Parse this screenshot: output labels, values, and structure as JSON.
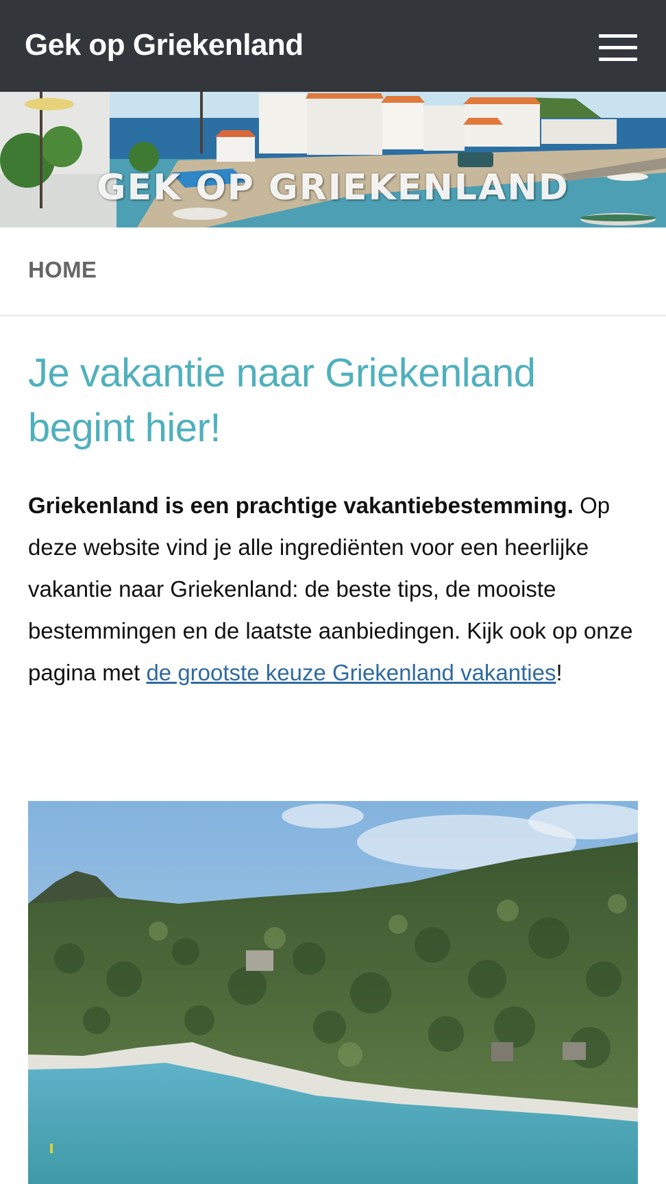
{
  "header": {
    "site_title": "Gek op Griekenland",
    "menu_icon": "hamburger-menu-icon",
    "background_color": "#33363b"
  },
  "banner": {
    "overlay_text": "GEK OP GRIEKENLAND"
  },
  "nav": {
    "items": [
      {
        "label": "HOME"
      }
    ]
  },
  "main": {
    "heading": "Je vakantie naar Griekenland begint hier!",
    "heading_color": "#4fb0bd",
    "intro": {
      "bold_text": "Griekenland is een prachtige vakantiebestemming.",
      "text": " Op deze website vind je alle ingrediënten voor een heerlijke vakantie naar Griekenland: de beste tips, de mooiste bestemmingen en de laatste aanbiedingen. Kijk ook op onze pagina met ",
      "link_text": "de grootste keuze Griekenland vakanties",
      "link_color": "#2f6a9f",
      "trailing_text": "!"
    }
  }
}
